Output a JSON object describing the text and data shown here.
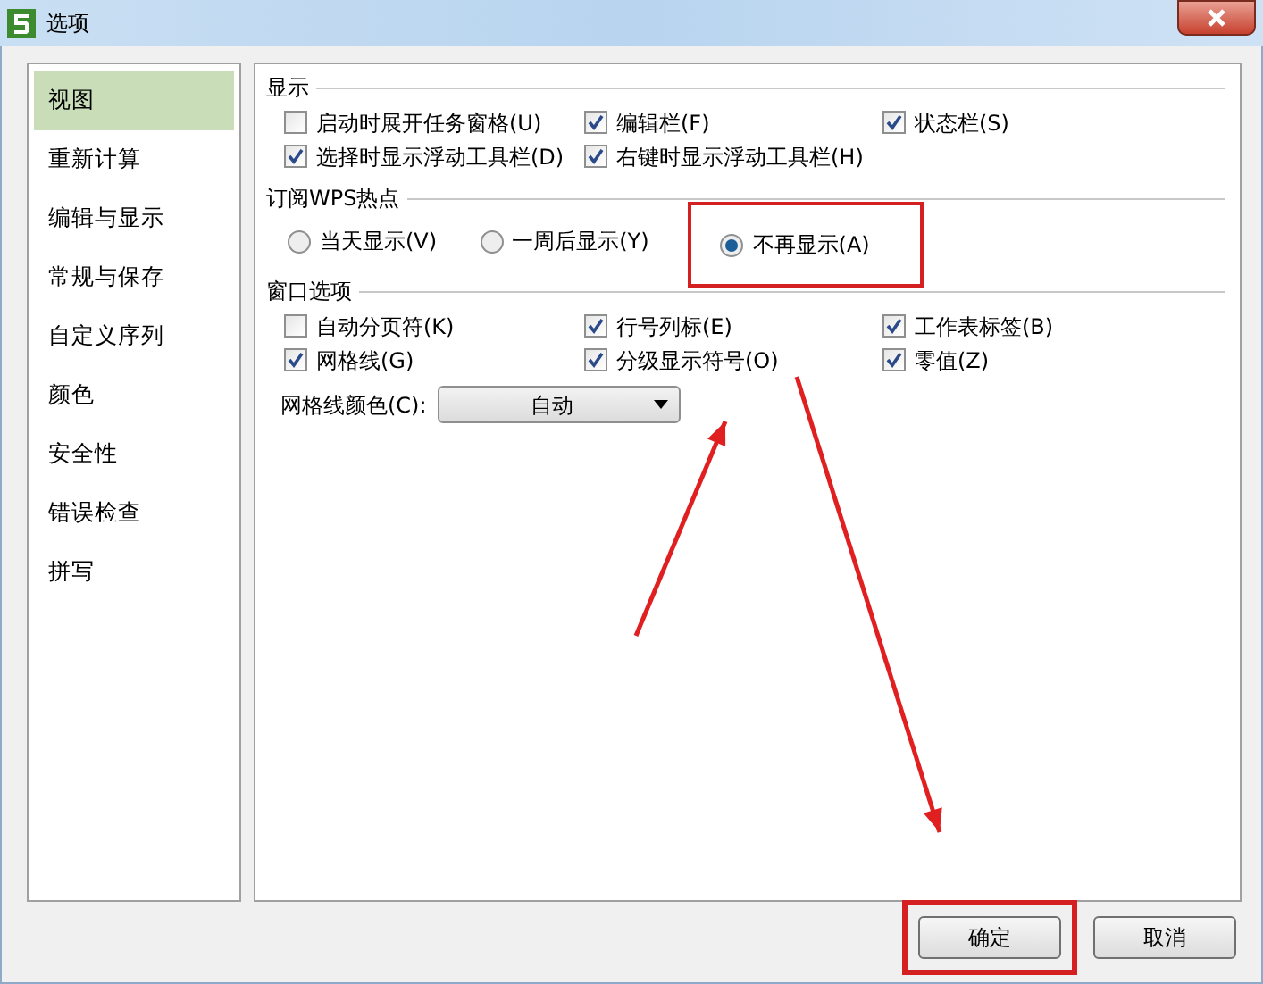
{
  "window": {
    "title": "选项"
  },
  "sidebar": {
    "items": [
      {
        "label": "视图",
        "selected": true
      },
      {
        "label": "重新计算",
        "selected": false
      },
      {
        "label": "编辑与显示",
        "selected": false
      },
      {
        "label": "常规与保存",
        "selected": false
      },
      {
        "label": "自定义序列",
        "selected": false
      },
      {
        "label": "颜色",
        "selected": false
      },
      {
        "label": "安全性",
        "selected": false
      },
      {
        "label": "错误检查",
        "selected": false
      },
      {
        "label": "拼写",
        "selected": false
      }
    ]
  },
  "sections": [
    {
      "title": "显示",
      "kind": "checkboxes",
      "items": [
        {
          "label": "启动时展开任务窗格(U)",
          "checked": false
        },
        {
          "label": "编辑栏(F)",
          "checked": true
        },
        {
          "label": "状态栏(S)",
          "checked": true
        },
        {
          "label": "选择时显示浮动工具栏(D)",
          "checked": true
        },
        {
          "label": "右键时显示浮动工具栏(H)",
          "checked": true
        }
      ]
    },
    {
      "title": "订阅WPS热点",
      "kind": "radios",
      "items": [
        {
          "label": "当天显示(V)",
          "selected": false,
          "highlighted": false
        },
        {
          "label": "一周后显示(Y)",
          "selected": false,
          "highlighted": false
        },
        {
          "label": "不再显示(A)",
          "selected": true,
          "highlighted": true
        }
      ]
    },
    {
      "title": "窗口选项",
      "kind": "checkboxes",
      "items": [
        {
          "label": "自动分页符(K)",
          "checked": false
        },
        {
          "label": "行号列标(E)",
          "checked": true
        },
        {
          "label": "工作表标签(B)",
          "checked": true
        },
        {
          "label": "网格线(G)",
          "checked": true
        },
        {
          "label": "分级显示符号(O)",
          "checked": true
        },
        {
          "label": "零值(Z)",
          "checked": true
        }
      ]
    }
  ],
  "gridline_color": {
    "label": "网格线颜色(C):",
    "value": "自动"
  },
  "buttons": [
    {
      "label": "确定",
      "highlighted": true
    },
    {
      "label": "取消",
      "highlighted": false
    }
  ],
  "annotations": [
    {
      "kind": "arrow"
    },
    {
      "kind": "arrow"
    }
  ]
}
